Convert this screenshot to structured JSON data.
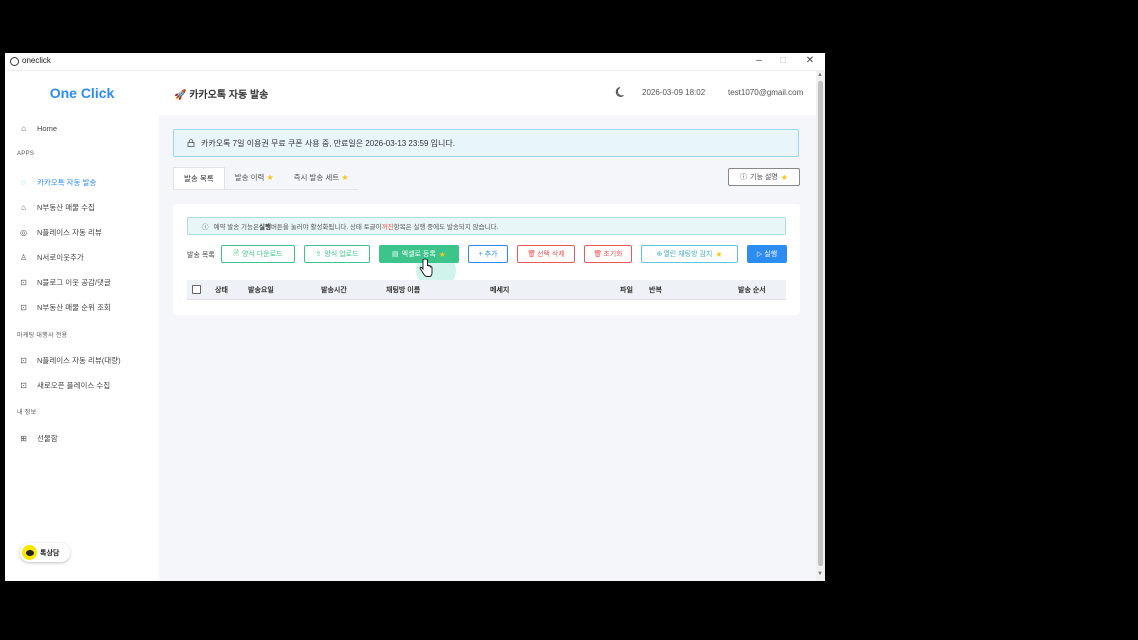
{
  "window": {
    "title": "oneclick"
  },
  "sidebar": {
    "brand": "One Click",
    "home": "Home",
    "section_apps": "APPS",
    "items_apps": [
      "카카오톡 자동 발송",
      "N부동산 매물 수집",
      "N플레이스 자동 리뷰",
      "N서로이웃추가",
      "N블로그 이웃 공감/댓글",
      "N부동산 매물 순위 조회"
    ],
    "section_marketing": "마케팅 대행사 전용",
    "items_marketing": [
      "N플레이스 자동 리뷰(대량)",
      "새로오픈 플레이스 수집"
    ],
    "section_myinfo": "내 정보",
    "items_myinfo": [
      "선물함"
    ],
    "kakao_button": "톡상담"
  },
  "header": {
    "title": "🚀 카카오톡 자동 발송",
    "datetime": "2026-03-09 18:02",
    "email": "test1070@gmail.com"
  },
  "info_bar": {
    "text": "카카오톡 7일 이용권 무료 쿠폰 사용 중, 만료일은 2026-03-13 23:59 입니다."
  },
  "tabs": [
    {
      "label": "발송 목록",
      "star": false
    },
    {
      "label": "발송 이력",
      "star": true
    },
    {
      "label": "즉시 발송 세트",
      "star": true
    }
  ],
  "feature_button": "기능 설명",
  "notice": {
    "part1": "예약 발송 기능은 ",
    "bold": "실행",
    "part2": " 버튼을 눌러야 활성화됩니다. 상태 토글이 ",
    "red": "꺼진",
    "part3": " 항목은 실행 중에도 발송되지 않습니다."
  },
  "toolbar": {
    "label": "발송 목록",
    "buttons": [
      "양식 다운로드",
      "양식 업로드",
      "엑셀로 등록",
      "+ 추가",
      "선택 삭제",
      "초기화",
      "열린 채팅방 감지",
      "실행"
    ]
  },
  "table": {
    "columns": [
      "상태",
      "발송요일",
      "발송시간",
      "채팅방 이름",
      "메세지",
      "파일",
      "반복",
      "발송 순서"
    ]
  },
  "colors": {
    "accent": "#2d8cf0",
    "green": "#3cc48a",
    "red": "#e85a5a",
    "star": "#f5c518"
  }
}
